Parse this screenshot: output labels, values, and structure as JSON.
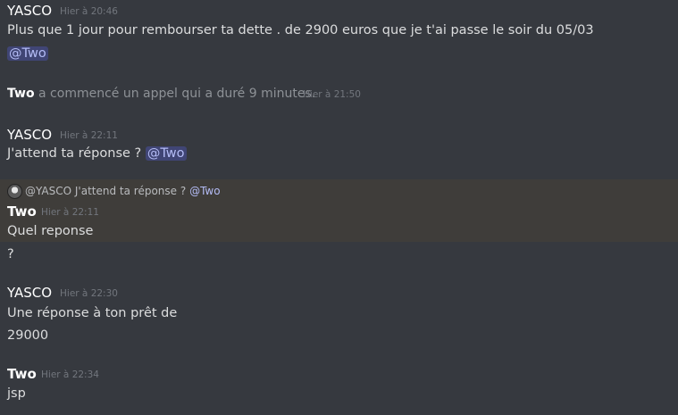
{
  "messages": [
    {
      "author": "YASCO",
      "timestamp": "Hier à 20:46",
      "lines": [
        "Plus que 1 jour pour rembourser ta dette . de 2900 euros que je t'ai passe le soir du 05/03"
      ],
      "mention": "@Two"
    },
    {
      "system": true,
      "author": "Two",
      "text": "a commencé un appel qui a duré 9 minutes.",
      "timestamp": "Hier à 21:50"
    },
    {
      "author": "YASCO",
      "timestamp": "Hier à 22:11",
      "text": "J'attend ta réponse ?",
      "mention": "@Two"
    },
    {
      "reply_to": {
        "mention_author": "@YASCO",
        "text": "J'attend ta réponse ?",
        "mention": "@Two"
      },
      "author": "Two",
      "timestamp": "Hier à 22:11",
      "lines": [
        "Quel reponse",
        "?"
      ]
    },
    {
      "author": "YASCO",
      "timestamp": "Hier à 22:30",
      "lines": [
        "Une réponse à ton prêt de",
        "29000"
      ]
    },
    {
      "author": "Two",
      "timestamp": "Hier à 22:34",
      "lines": [
        "jsp"
      ]
    }
  ],
  "colors": {
    "background": "#36393f",
    "mention": "#b4bcf6",
    "timestamp": "#72767d",
    "reply_highlight": "#3f3d3a"
  }
}
